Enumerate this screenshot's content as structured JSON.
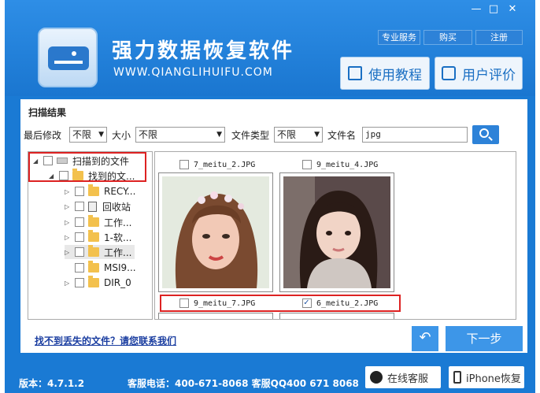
{
  "window": {
    "minimize": "—",
    "maximize": "□",
    "close": "✕"
  },
  "header": {
    "title": "强力数据恢复软件",
    "url": "WWW.QIANGLIHUIFU.COM",
    "top_buttons": [
      "专业服务",
      "购买",
      "注册"
    ],
    "tutorial": "使用教程",
    "reviews": "用户评价"
  },
  "results": {
    "title": "扫描结果",
    "filters": {
      "modified_label": "最后修改",
      "modified_value": "不限",
      "size_label": "大小",
      "size_value": "不限",
      "type_label": "文件类型",
      "type_value": "不限",
      "name_label": "文件名",
      "name_value": "jpg"
    }
  },
  "tree": [
    {
      "label": "扫描到的文件",
      "icon": "drive-icon"
    },
    {
      "label": "找到的文...",
      "icon": "folder-icon"
    },
    {
      "label": "RECY...",
      "icon": "folder-icon"
    },
    {
      "label": "回收站",
      "icon": "recycle-bin-icon"
    },
    {
      "label": "工作...",
      "icon": "folder-icon"
    },
    {
      "label": "1-软...",
      "icon": "folder-icon"
    },
    {
      "label": "工作...",
      "icon": "folder-icon"
    },
    {
      "label": "MSI9...",
      "icon": "folder-icon"
    },
    {
      "label": "DIR_0",
      "icon": "folder-icon"
    }
  ],
  "files": [
    {
      "name": "7_meitu_2.JPG",
      "checked": false
    },
    {
      "name": "9_meitu_4.JPG",
      "checked": false
    },
    {
      "name": "9_meitu_7.JPG",
      "checked": false
    },
    {
      "name": "6_meitu_2.JPG",
      "checked": true
    }
  ],
  "help_link": "找不到丢失的文件？请您联系我们",
  "next_button": "下一步",
  "footer": {
    "version": "版本：4.7.1.2",
    "phone": "客服电话：400-671-8068 客服QQ400 671 8068",
    "online_service": "在线客服",
    "iphone_recovery": "iPhone恢复"
  },
  "colors": {
    "brand_blue": "#1a7ad4",
    "highlight_red": "#d22222"
  }
}
